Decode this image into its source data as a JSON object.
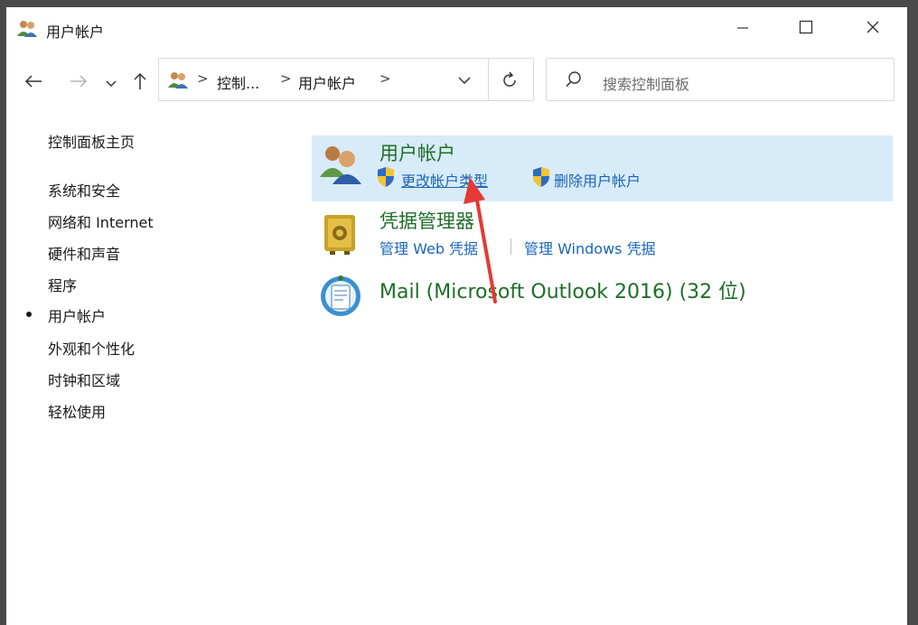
{
  "window": {
    "title": "用户帐户",
    "title_icon": "users-icon",
    "controls": [
      "minimize-icon",
      "maximize-icon",
      "close-icon"
    ]
  },
  "nav": {
    "back_icon": "arrow-left-icon",
    "forward_icon": "arrow-right-icon",
    "recent_icon": "chevron-down-icon",
    "up_icon": "arrow-up-icon"
  },
  "address": {
    "breadcrumbs": [
      "控制...",
      "用户帐户"
    ],
    "separator": ">",
    "dropdown_icon": "chevron-down-icon",
    "refresh_icon": "refresh-icon"
  },
  "search": {
    "placeholder": "搜索控制面板",
    "icon": "search-icon"
  },
  "sidebar": {
    "home": "控制面板主页",
    "items": [
      {
        "label": "系统和安全",
        "selected": false
      },
      {
        "label": "网络和 Internet",
        "selected": false
      },
      {
        "label": "硬件和声音",
        "selected": false
      },
      {
        "label": "程序",
        "selected": false
      },
      {
        "label": "用户帐户",
        "selected": true
      },
      {
        "label": "外观和个性化",
        "selected": false
      },
      {
        "label": "时钟和区域",
        "selected": false
      },
      {
        "label": "轻松使用",
        "selected": false
      }
    ]
  },
  "categories": [
    {
      "title": "用户帐户",
      "icon": "user-accounts-icon",
      "highlighted": true,
      "links": [
        {
          "label": "更改帐户类型",
          "shield": true
        },
        {
          "label": "删除用户帐户",
          "shield": true
        }
      ]
    },
    {
      "title": "凭据管理器",
      "icon": "credential-manager-icon",
      "highlighted": false,
      "links": [
        {
          "label": "管理 Web 凭据",
          "shield": false
        },
        {
          "label": "管理 Windows 凭据",
          "shield": false
        }
      ]
    },
    {
      "title": "Mail (Microsoft Outlook 2016) (32 位)",
      "icon": "mail-icon",
      "highlighted": false,
      "links": []
    }
  ],
  "colors": {
    "category_title": "#1e6e28",
    "link": "#1a66b8",
    "highlight": "#d8ebf9",
    "annotation_arrow": "#e53935"
  }
}
